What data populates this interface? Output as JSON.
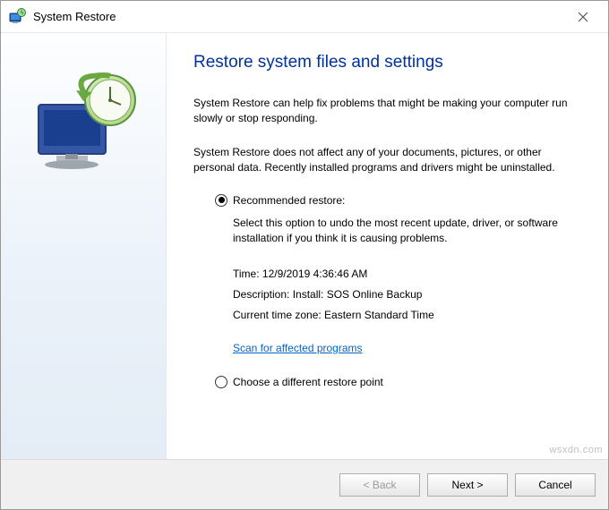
{
  "window": {
    "title": "System Restore"
  },
  "heading": "Restore system files and settings",
  "intro1": "System Restore can help fix problems that might be making your computer run slowly or stop responding.",
  "intro2": "System Restore does not affect any of your documents, pictures, or other personal data. Recently installed programs and drivers might be uninstalled.",
  "options": {
    "recommended": {
      "label": "Recommended restore:",
      "detail": "Select this option to undo the most recent update, driver, or software installation if you think it is causing problems.",
      "time": "Time: 12/9/2019 4:36:46 AM",
      "description": "Description: Install: SOS Online Backup",
      "timezone": "Current time zone: Eastern Standard Time"
    },
    "scan_link": "Scan for affected programs",
    "different": {
      "label": "Choose a different restore point"
    }
  },
  "buttons": {
    "back": "< Back",
    "next": "Next >",
    "cancel": "Cancel"
  },
  "watermark": "wsxdn.com"
}
